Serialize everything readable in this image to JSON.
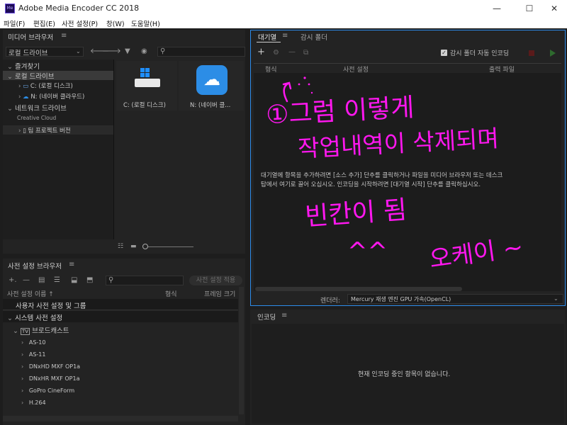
{
  "window": {
    "title": "Adobe Media Encoder CC 2018",
    "app_icon": "Me",
    "minimize": "—",
    "maximize": "☐",
    "close": "✕"
  },
  "menu": [
    "파일(F)",
    "편집(E)",
    "사전 설정(P)",
    "창(W)",
    "도움말(H)"
  ],
  "media_browser": {
    "title": "미디어 브라우저",
    "location": "로컬 드라이브",
    "tree": [
      {
        "label": "즐겨찾기",
        "level": 0
      },
      {
        "label": "로컬 드라이브",
        "level": 0
      },
      {
        "label": "C: (로컬 디스크)",
        "level": 1
      },
      {
        "label": "N: (네이버 클라우드)",
        "level": 1
      },
      {
        "label": "네트워크 드라이브",
        "level": 0
      },
      {
        "label": "Creative Cloud",
        "level": 0
      },
      {
        "label": "팀 프로젝트 버전",
        "level": 1
      }
    ],
    "thumbnails": [
      {
        "label": "C: (로컬 디스크)"
      },
      {
        "label": "N: (네이버 클..."
      }
    ]
  },
  "preset_browser": {
    "title": "사전 설정 브라우저",
    "apply_button": "사전 설정 적용",
    "columns": {
      "name": "사전 설정 이름 ↑",
      "format": "형식",
      "frame_size": "프레임 크기"
    },
    "groups": [
      "사용자 사전 설정 및 그룹",
      "시스템 사전 설정"
    ],
    "category": "브로드캐스트",
    "items": [
      "AS-10",
      "AS-11",
      "DNxHD MXF OP1a",
      "DNxHR MXF OP1a",
      "GoPro CineForm",
      "H.264"
    ]
  },
  "queue": {
    "tabs": [
      "대기열",
      "감시 폴더"
    ],
    "auto_encode": "감시 폴더 자동 인코딩",
    "columns": [
      "형식",
      "사전 설정",
      "출력 파일"
    ],
    "empty_message_line1": "대기열에 항목을 추가하려면 [소스 추가] 단추를 클릭하거나 파일을 미디어 브라우저 또는 데스크",
    "empty_message_line2": "탑에서 여기로 끌어 오십시오. 인코딩을 시작하려면 [대기열 시작] 단추를 클릭하십시오.",
    "renderer_label": "렌더러:",
    "renderer_value": "Mercury 재생 엔진 GPU 가속(OpenCL)"
  },
  "encoding": {
    "title": "인코딩",
    "empty_message": "현재 인코딩 중인 항목이 없습니다."
  },
  "annotation": {
    "line1": "①그럼 이렇게",
    "line2": "작업내역이 삭제되며",
    "line3": "빈칸이 됨",
    "smile": "^^",
    "okay": "오케이 ~"
  },
  "colors": {
    "accent": "#2d8ceb",
    "handwriting": "#ff17ef",
    "start_green": "#2e9a2e",
    "stop_red": "#b02020"
  }
}
